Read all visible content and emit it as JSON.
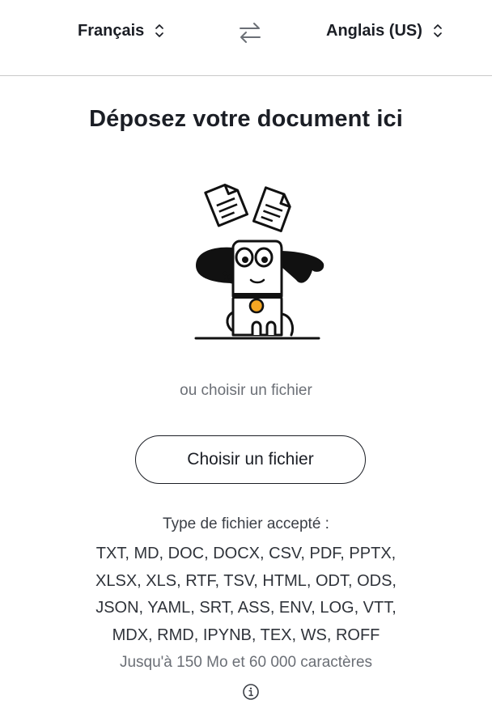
{
  "header": {
    "source_language": "Français",
    "target_language": "Anglais (US)",
    "swap_icon": "swap-arrows-icon",
    "chevron_icon": "up-down-chevron-icon"
  },
  "main": {
    "title": "Déposez votre document ici",
    "illustration": "dog-with-documents",
    "or_choose": "ou choisir un fichier",
    "choose_button": "Choisir un fichier",
    "accepted_title": "Type de fichier accepté :",
    "formats": [
      "TXT, MD, DOC, DOCX, CSV, PDF, PPTX,",
      "XLSX, XLS, RTF, TSV, HTML, ODT, ODS,",
      "JSON, YAML, SRT, ASS, ENV, LOG, VTT,",
      "MDX, RMD, IPYNB, TEX, WS, ROFF"
    ],
    "limits": "Jusqu'à 150 Mo et 60 000 caractères",
    "info_icon": "info-icon"
  },
  "colors": {
    "text": "#1b1e25",
    "muted": "#6b6f76",
    "collar_tag": "#f5a623"
  }
}
